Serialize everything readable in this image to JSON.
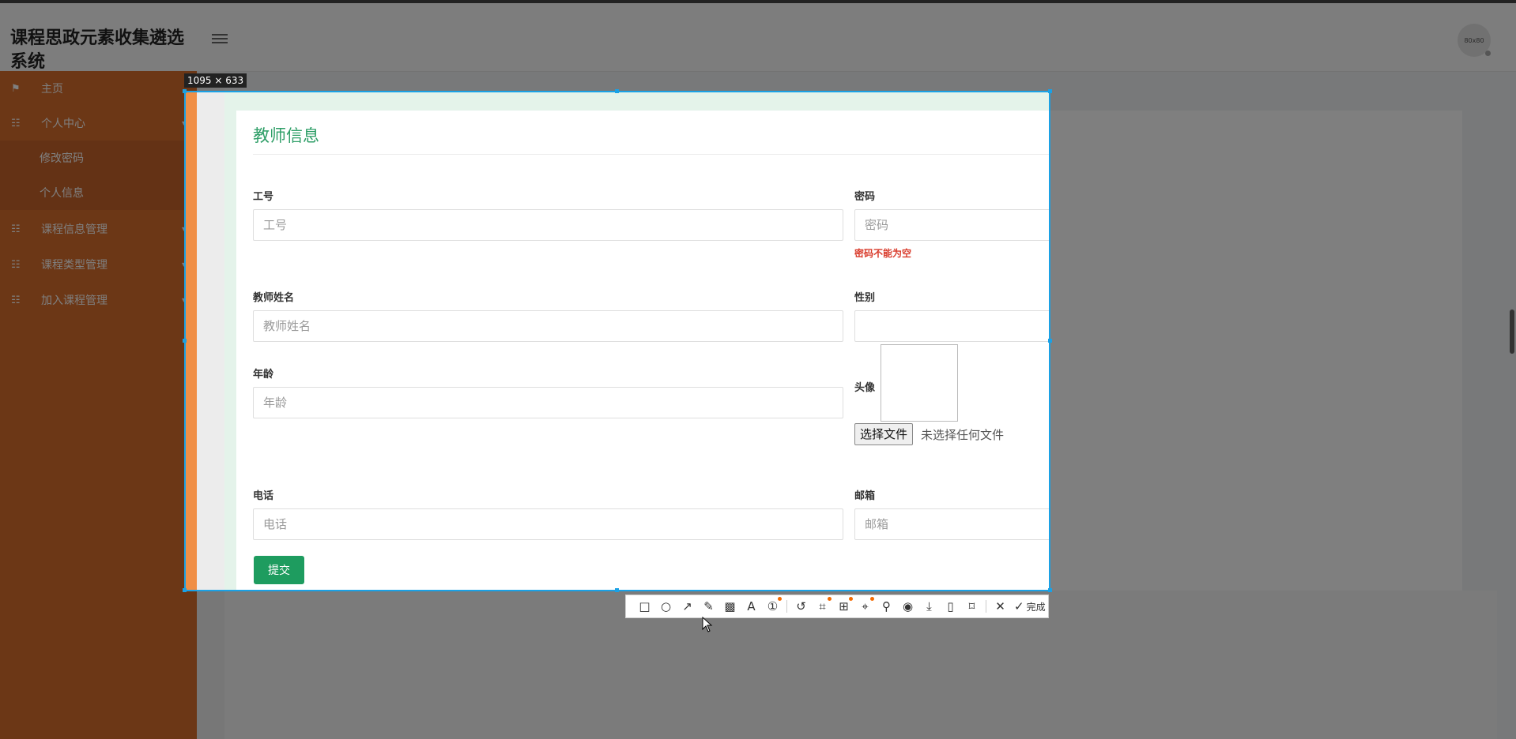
{
  "app": {
    "title": "课程思政元素收集遴选系统",
    "avatar_text": "80x80"
  },
  "sidebar": {
    "items": [
      {
        "label": "主页",
        "icon": "flag-icon"
      },
      {
        "label": "个人中心",
        "icon": "grid-icon"
      },
      {
        "label": "修改密码",
        "icon": ""
      },
      {
        "label": "个人信息",
        "icon": ""
      },
      {
        "label": "课程信息管理",
        "icon": "grid-icon"
      },
      {
        "label": "课程类型管理",
        "icon": "grid-icon"
      },
      {
        "label": "加入课程管理",
        "icon": "grid-icon"
      }
    ]
  },
  "form": {
    "title": "教师信息",
    "fields": {
      "gonghao": {
        "label": "工号",
        "placeholder": "工号"
      },
      "mima": {
        "label": "密码",
        "placeholder": "密码",
        "error": "密码不能为空"
      },
      "xingming": {
        "label": "教师姓名",
        "placeholder": "教师姓名"
      },
      "xingbie": {
        "label": "性别",
        "value": ""
      },
      "nianling": {
        "label": "年龄",
        "placeholder": "年龄"
      },
      "touxiang": {
        "label": "头像",
        "button": "选择文件",
        "status": "未选择任何文件"
      },
      "dianhua": {
        "label": "电话",
        "placeholder": "电话"
      },
      "youxiang": {
        "label": "邮箱",
        "placeholder": "邮箱"
      }
    },
    "submit_label": "提交"
  },
  "capture": {
    "size_label": "1095 × 633",
    "accent_color": "#1aa1e5",
    "toolbar": [
      "rectangle-icon",
      "ellipse-icon",
      "arrow-icon",
      "pencil-icon",
      "mosaic-icon",
      "text-icon",
      "number-marker-icon",
      "undo-icon",
      "ocr-icon",
      "translate-icon",
      "scan-icon",
      "pin-icon",
      "record-icon",
      "download-icon",
      "save-icon",
      "bookmark-icon",
      "close-icon",
      "check-icon"
    ],
    "done_label": "完成"
  }
}
